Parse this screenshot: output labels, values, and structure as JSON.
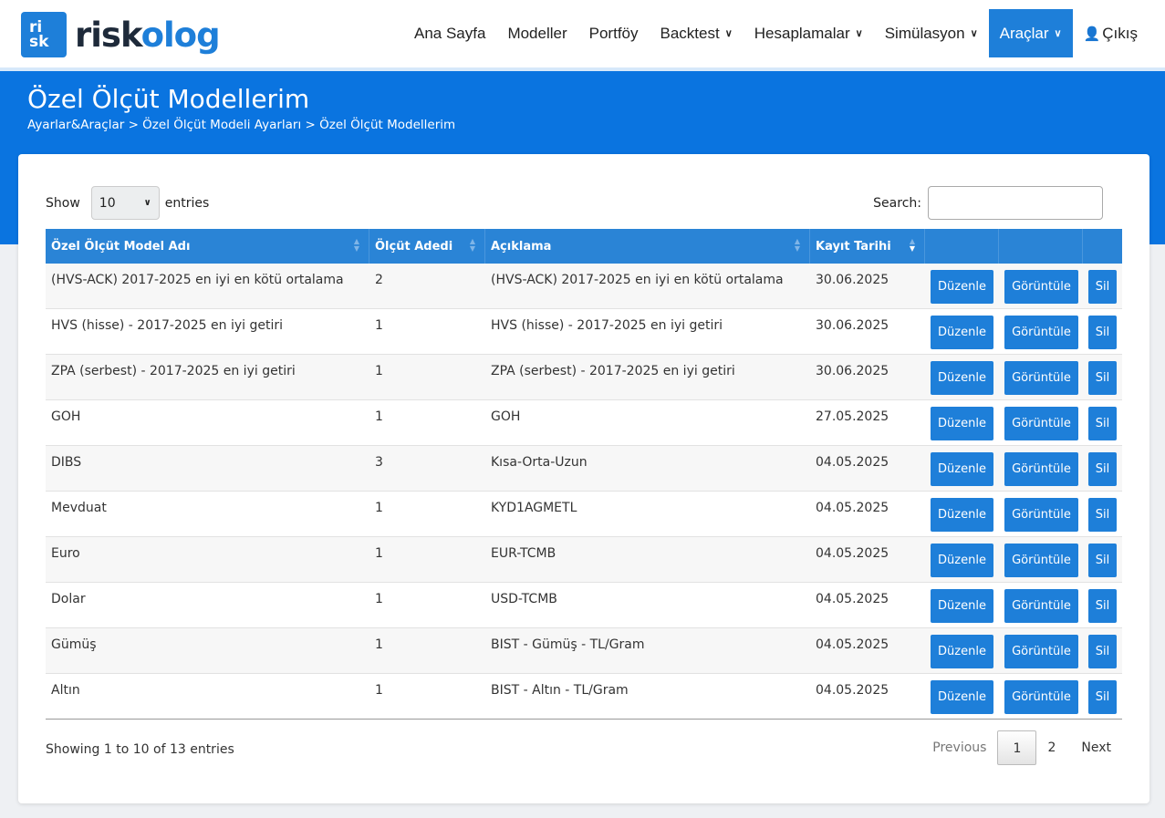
{
  "brand": {
    "box_line1": "ri",
    "box_line2": "sk",
    "name_part1": "risk",
    "name_part2": "olog"
  },
  "nav": [
    {
      "label": "Ana Sayfa",
      "dropdown": false,
      "active": false
    },
    {
      "label": "Modeller",
      "dropdown": false,
      "active": false
    },
    {
      "label": "Portföy",
      "dropdown": false,
      "active": false
    },
    {
      "label": "Backtest",
      "dropdown": true,
      "active": false
    },
    {
      "label": "Hesaplamalar",
      "dropdown": true,
      "active": false
    },
    {
      "label": "Simülasyon",
      "dropdown": true,
      "active": false
    },
    {
      "label": "Araçlar",
      "dropdown": true,
      "active": true
    },
    {
      "label": "Çıkış",
      "dropdown": false,
      "active": false,
      "icon": "user-icon"
    }
  ],
  "page": {
    "title": "Özel Ölçüt Modellerim",
    "breadcrumb": "Ayarlar&Araçlar > Özel Ölçüt Modeli Ayarları > Özel Ölçüt Modellerim"
  },
  "controls": {
    "show_label": "Show",
    "page_size": "10",
    "entries_label": "entries",
    "search_label": "Search:",
    "search_value": ""
  },
  "table": {
    "headers": [
      "Özel Ölçüt Model Adı",
      "Ölçüt Adedi",
      "Açıklama",
      "Kayıt Tarihi",
      "",
      "",
      ""
    ],
    "sorted_column": "Kayıt Tarihi",
    "sort_direction": "desc",
    "rows": [
      {
        "name": "(HVS-ACK) 2017-2025 en iyi en kötü ortalama",
        "count": "2",
        "desc": "(HVS-ACK) 2017-2025 en iyi en kötü ortalama",
        "date": "30.06.2025"
      },
      {
        "name": "HVS (hisse) - 2017-2025 en iyi getiri",
        "count": "1",
        "desc": "HVS (hisse) - 2017-2025 en iyi getiri",
        "date": "30.06.2025"
      },
      {
        "name": "ZPA (serbest) - 2017-2025 en iyi getiri",
        "count": "1",
        "desc": "ZPA (serbest) - 2017-2025 en iyi getiri",
        "date": "30.06.2025"
      },
      {
        "name": "GOH",
        "count": "1",
        "desc": "GOH",
        "date": "27.05.2025"
      },
      {
        "name": "DIBS",
        "count": "3",
        "desc": "Kısa-Orta-Uzun",
        "date": "04.05.2025"
      },
      {
        "name": "Mevduat",
        "count": "1",
        "desc": "KYD1AGMETL",
        "date": "04.05.2025"
      },
      {
        "name": "Euro",
        "count": "1",
        "desc": "EUR-TCMB",
        "date": "04.05.2025"
      },
      {
        "name": "Dolar",
        "count": "1",
        "desc": "USD-TCMB",
        "date": "04.05.2025"
      },
      {
        "name": "Gümüş",
        "count": "1",
        "desc": "BIST - Gümüş - TL/Gram",
        "date": "04.05.2025"
      },
      {
        "name": "Altın",
        "count": "1",
        "desc": "BIST - Altın - TL/Gram",
        "date": "04.05.2025"
      }
    ],
    "buttons": {
      "edit": "Düzenle",
      "view": "Görüntüle",
      "delete": "Sil"
    }
  },
  "footer": {
    "info": "Showing 1 to 10 of 13 entries",
    "previous": "Previous",
    "pages": [
      "1",
      "2"
    ],
    "current_page": "1",
    "next": "Next"
  },
  "colors": {
    "primary": "#1e7fd9",
    "band": "#0a74e0",
    "table_header": "#2a84d6"
  }
}
